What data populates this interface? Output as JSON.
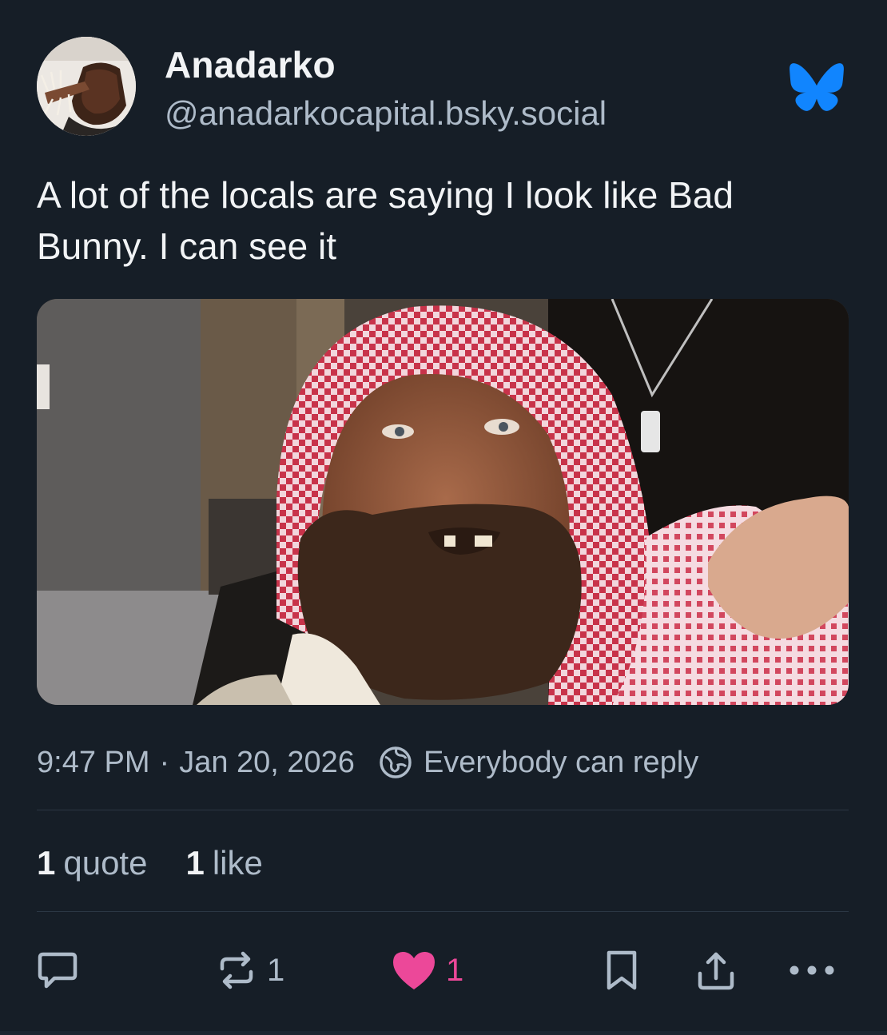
{
  "colors": {
    "background": "#161e27",
    "primary_text": "#f1f3f5",
    "secondary_text": "#aebbc9",
    "bluesky_blue": "#1185fe",
    "like_pink": "#ec4899",
    "divider": "#2b3744"
  },
  "author": {
    "display_name": "Anadarko",
    "handle": "@anadarkocapital.bsky.social",
    "avatar_icon": "avatar-photo",
    "platform_icon": "bluesky-butterfly-icon"
  },
  "post": {
    "text": "A lot of the locals are saying I look like Bad Bunny. I can see it",
    "image_icon": "photo-bearded-man-red-keffiyeh"
  },
  "meta": {
    "time": "9:47 PM",
    "separator": "·",
    "date": "Jan 20, 2026",
    "reply_setting": "Everybody can reply",
    "reply_icon": "globe-icon"
  },
  "stats": {
    "quotes_count": "1",
    "quotes_label": "quote",
    "likes_count": "1",
    "likes_label": "like"
  },
  "actions": {
    "reply_icon": "reply-bubble-icon",
    "repost_icon": "repost-icon",
    "repost_count": "1",
    "like_icon": "heart-icon",
    "like_count": "1",
    "bookmark_icon": "bookmark-icon",
    "share_icon": "share-icon",
    "more_icon": "more-dots-icon"
  }
}
